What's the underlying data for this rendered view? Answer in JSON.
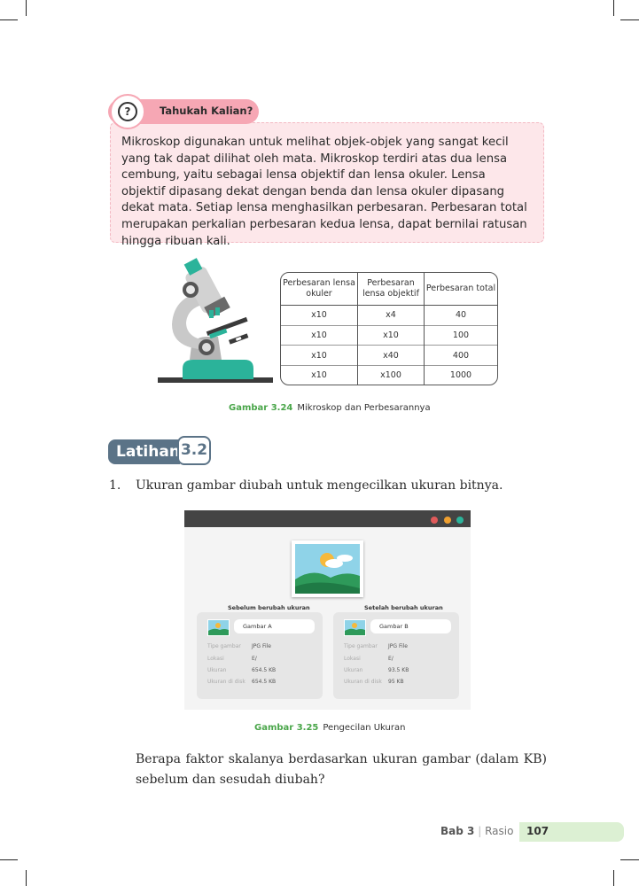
{
  "info": {
    "title": "Tahukah Kalian?",
    "icon": "question-icon",
    "body": "Mikroskop digunakan untuk melihat objek-objek yang sangat kecil yang tak dapat dilihat oleh mata. Mikroskop terdiri atas dua lensa cembung, yaitu sebagai lensa objektif dan lensa okuler. Lensa objektif dipasang dekat dengan benda dan lensa okuler dipasang dekat mata. Setiap lensa menghasilkan perbesaran. Perbesaran total merupakan perkalian perbesaran kedua lensa, dapat bernilai ratusan hingga ribuan kali."
  },
  "table": {
    "headers": [
      "Perbesaran lensa okuler",
      "Perbesaran lensa objektif",
      "Perbesaran total"
    ],
    "rows": [
      [
        "x10",
        "x4",
        "40"
      ],
      [
        "x10",
        "x10",
        "100"
      ],
      [
        "x10",
        "x40",
        "400"
      ],
      [
        "x10",
        "x100",
        "1000"
      ]
    ]
  },
  "figure1": {
    "number": "Gambar 3.24",
    "caption": "Mikroskop dan Perbesarannya"
  },
  "exercise": {
    "label": "Latihan",
    "number": "3.2"
  },
  "question1": {
    "number": "1.",
    "text": "Ukuran gambar diubah untuk mengecilkan ukuran bitnya."
  },
  "window": {
    "before_label": "Sebelum berubah ukuran",
    "after_label": "Setelah berubah ukuran",
    "cards": [
      {
        "name": "Gambar A",
        "type_key": "Tipe gambar",
        "type_val": "JPG File",
        "loc_key": "Lokasi",
        "loc_val": "E/",
        "size_key": "Ukuran",
        "size_val": "654.5 KB",
        "disk_key": "Ukuran di disk",
        "disk_val": "654.5 KB"
      },
      {
        "name": "Gambar B",
        "type_key": "Tipe gambar",
        "type_val": "JPG File",
        "loc_key": "Lokasi",
        "loc_val": "E/",
        "size_key": "Ukuran",
        "size_val": "93.5 KB",
        "disk_key": "Ukuran di disk",
        "disk_val": "95 KB"
      }
    ],
    "dot_colors": [
      "#e05a5a",
      "#f0a030",
      "#2bb39a"
    ]
  },
  "figure2": {
    "number": "Gambar 3.25",
    "caption": "Pengecilan Ukuran"
  },
  "question1_followup": "Berapa faktor skalanya berdasarkan ukuran gambar (dalam KB) sebelum dan sesudah diubah?",
  "footer": {
    "chapter": "Bab 3",
    "separator": "|",
    "topic": "Rasio",
    "page": "107"
  },
  "colors": {
    "accent_pink": "#f6a7b4",
    "accent_green": "#4aa64a",
    "latihan_blue": "#5b7387",
    "footer_green": "#dcf0d3"
  }
}
